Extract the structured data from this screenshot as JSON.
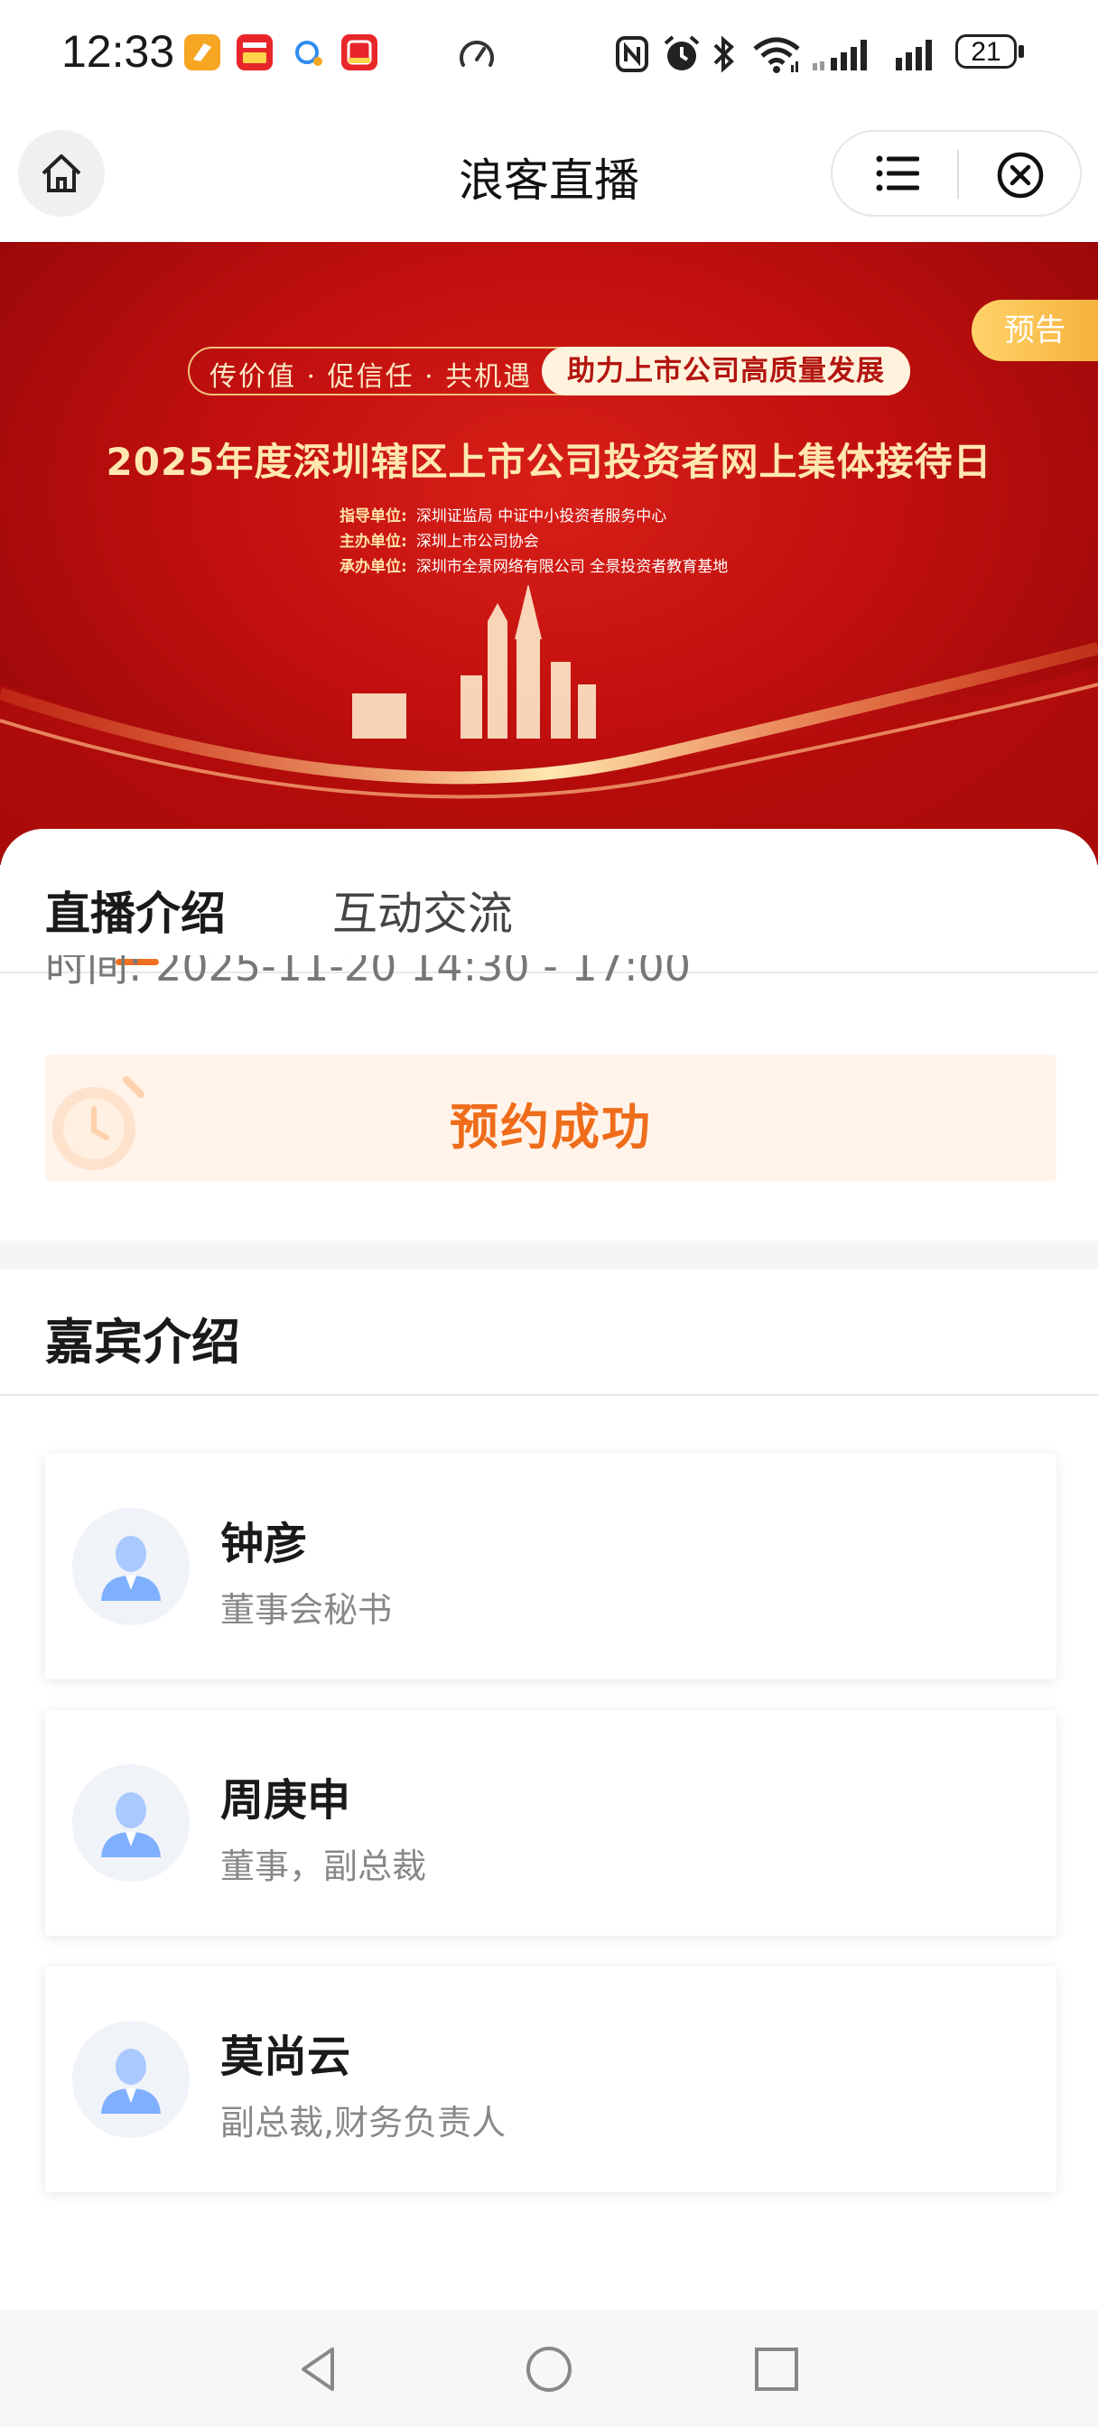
{
  "status_bar": {
    "time": "12:33",
    "battery_level": "21",
    "app_icons": [
      {
        "name": "app-icon-1",
        "color": "#f6a623"
      },
      {
        "name": "app-icon-2",
        "color": "#e8262a"
      },
      {
        "name": "app-icon-3",
        "color": "#2f8cf0"
      },
      {
        "name": "app-icon-4",
        "color": "#e8262a"
      }
    ],
    "icons": [
      "speed-icon",
      "nfc-icon",
      "alarm-icon",
      "bluetooth-icon",
      "wifi-icon",
      "signal-icon",
      "signal-icon",
      "battery-icon"
    ]
  },
  "navbar": {
    "title": "浪客直播",
    "home_icon": "home-icon",
    "menu_icon": "menu-icon",
    "close_icon": "close-icon"
  },
  "banner": {
    "badge": "预告",
    "slogan_left": "传价值 · 促信任 · 共机遇",
    "slogan_right": "助力上市公司高质量发展",
    "title": "2025年度深圳辖区上市公司投资者网上集体接待日",
    "orgs": [
      {
        "label": "指导单位:",
        "value": "深圳证监局   中证中小投资者服务中心"
      },
      {
        "label": "主办单位:",
        "value": "深圳上市公司协会"
      },
      {
        "label": "承办单位:",
        "value": "深圳市全景网络有限公司   全景投资者教育基地"
      }
    ],
    "colors": {
      "red": "#c00f0e",
      "gold": "#ffe7b0"
    }
  },
  "tabs": [
    {
      "label": "直播介绍",
      "active": true
    },
    {
      "label": "互动交流",
      "active": false
    }
  ],
  "live_time": "时间: 2025-11-20 14:30 - 17:00",
  "reserve": {
    "label": "预约成功",
    "color": "#ef6c1a"
  },
  "guests": {
    "header": "嘉宾介绍",
    "items": [
      {
        "name": "钟彦",
        "role": "董事会秘书"
      },
      {
        "name": "周庚申",
        "role": "董事，副总裁"
      },
      {
        "name": "莫尚云",
        "role": "副总裁,财务负责人"
      }
    ]
  },
  "system_nav": [
    "back-icon",
    "home-circle-icon",
    "recents-icon"
  ]
}
